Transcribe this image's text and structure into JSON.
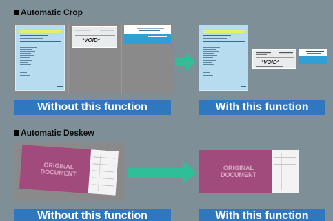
{
  "sections": {
    "crop": {
      "title": "Automatic Crop",
      "without_label": "Without this function",
      "with_label": "With this function"
    },
    "deskew": {
      "title": "Automatic Deskew",
      "without_label": "Without this function",
      "with_label": "With this function"
    }
  },
  "documents": {
    "check_void": "*VOID*",
    "pink_doc_text": [
      "ORIGINAL",
      "DOCUMENT"
    ]
  },
  "colors": {
    "background": "#7e8f98",
    "label_bar": "#2f78bf",
    "arrow": "#2fbf96",
    "form_doc": "#b8dcef",
    "pink_doc": "#a04b7c"
  },
  "icons": {
    "crop_arrow": "right-arrow-icon",
    "deskew_arrow": "right-arrow-icon"
  }
}
